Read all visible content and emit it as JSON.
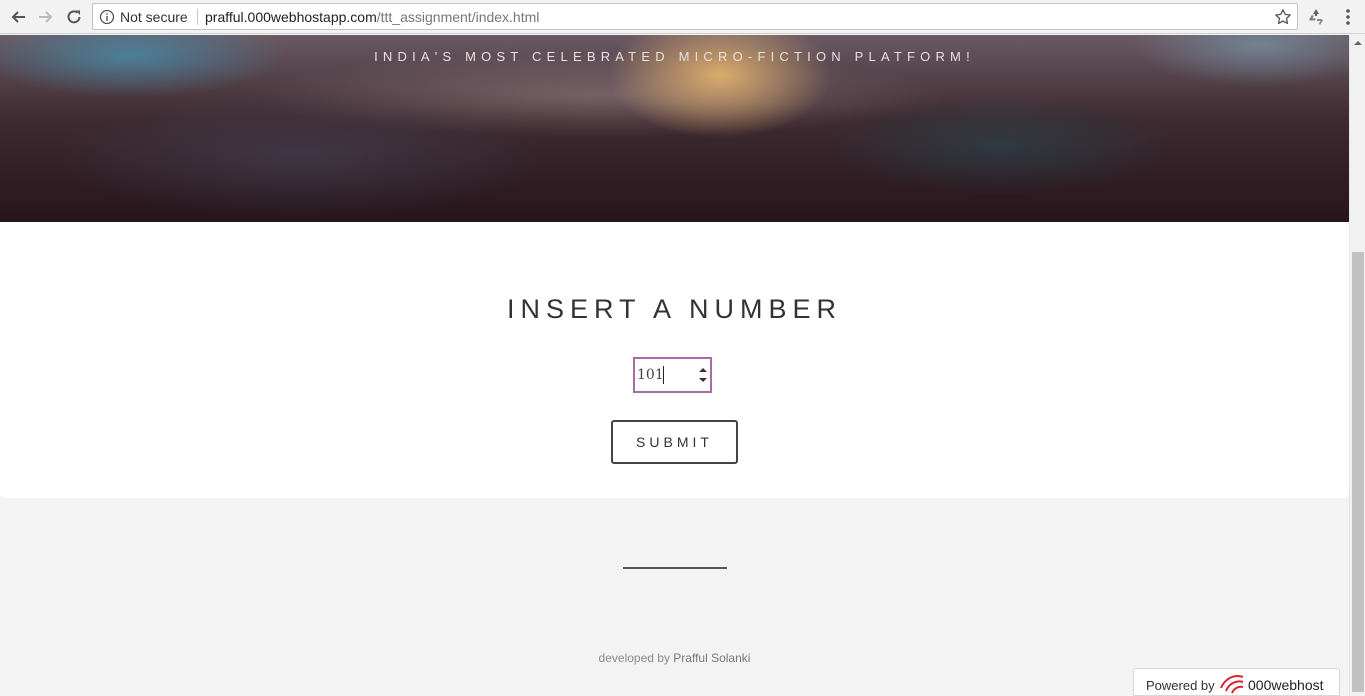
{
  "browser": {
    "security_label": "Not secure",
    "url_host": "prafful.000webhostapp.com",
    "url_path": "/ttt_assignment/index.html"
  },
  "hero": {
    "tagline": "INDIA'S MOST CELEBRATED MICRO-FICTION PLATFORM!"
  },
  "form": {
    "heading": "INSERT A NUMBER",
    "number_value": "101",
    "submit_label": "SUBMIT"
  },
  "footer": {
    "credit_prefix": "developed by ",
    "credit_name": "Prafful Solanki"
  },
  "badge": {
    "powered_label": "Powered by",
    "brand_name": "000webhost"
  },
  "colors": {
    "field_border": "#a46fa4",
    "hero_glow": "#e2b06e",
    "brand_red": "#d9232d"
  },
  "icons": [
    "back-arrow-icon",
    "forward-arrow-icon",
    "reload-icon",
    "info-icon",
    "star-icon",
    "extension-icon",
    "menu-icon",
    "stepper-icon",
    "000webhost-logo"
  ]
}
